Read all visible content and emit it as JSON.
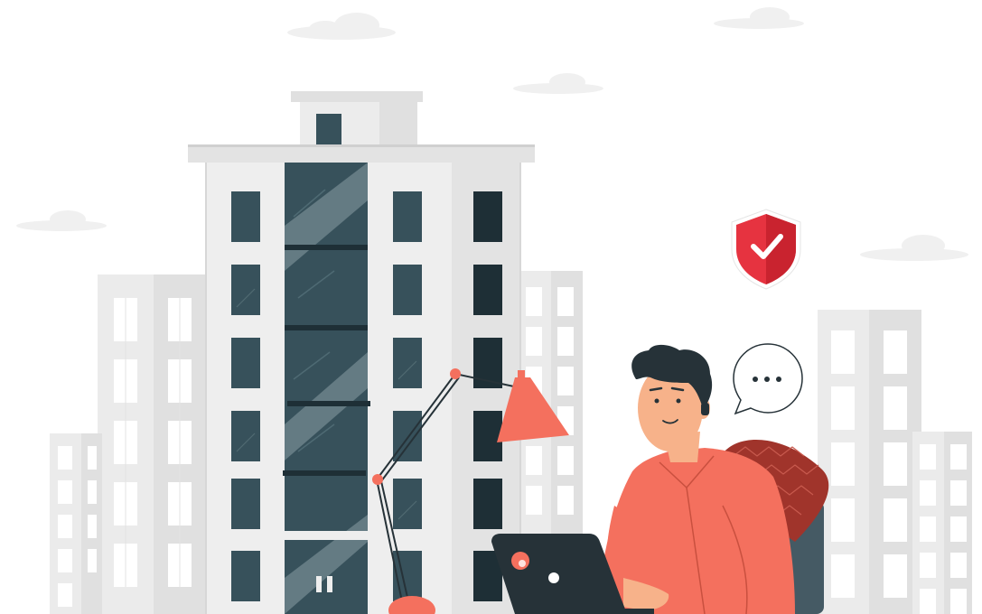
{
  "illustration": {
    "subject": "man-working-on-laptop-in-office",
    "icons": [
      "shield-check-icon",
      "speech-bubble-icon",
      "desk-lamp-icon",
      "laptop-icon",
      "cloud-icon",
      "building-icon"
    ],
    "colors": {
      "accent": "#f4705e",
      "shield_red": "#e63340",
      "dark_teal": "#37515b",
      "window_dark": "#1e2f36",
      "building_light": "#eeeeee",
      "building_mid": "#e3e3e3",
      "background_building": "#ebebeb",
      "cloud": "#f0f0f0",
      "laptop": "#263238",
      "chair": "#455a64",
      "hair": "#263238",
      "skin": "#f7b28a"
    }
  }
}
